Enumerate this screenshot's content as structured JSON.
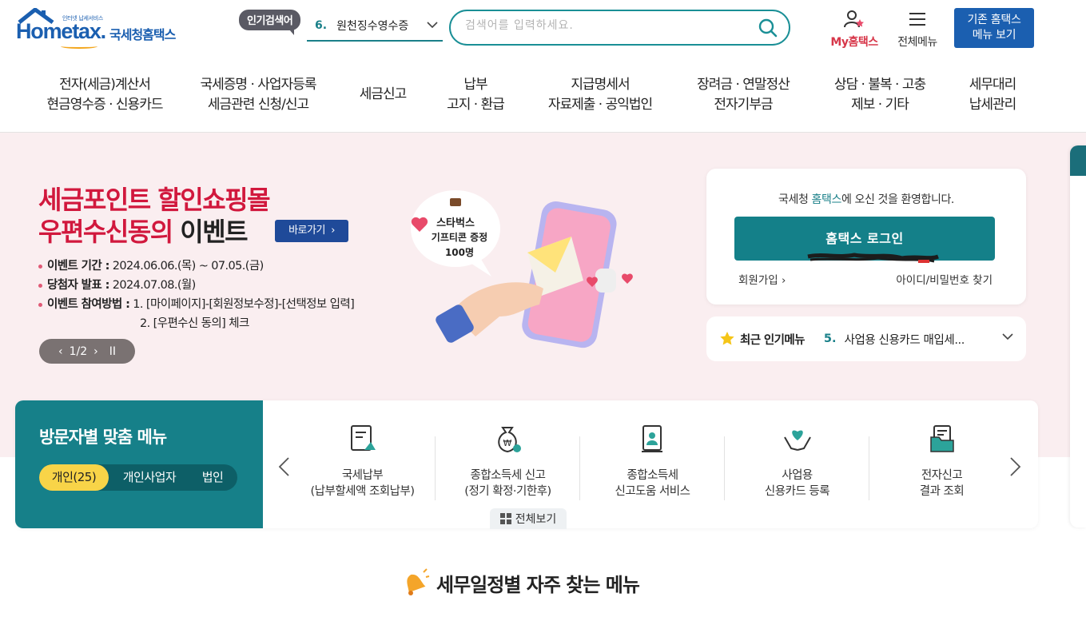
{
  "header": {
    "logo": {
      "small_text": "인터넷 납세서비스",
      "word": "Hometax.",
      "kor": "국세청홈택스"
    },
    "popular_badge": "인기검색어",
    "popular_num": "6.",
    "popular_term": "원천징수영수증",
    "search_placeholder": "검색어를 입력하세요.",
    "my_hometax": "My홈택스",
    "all_menu": "전체메뉴",
    "old_line1": "기존 홈택스",
    "old_line2": "메뉴 보기"
  },
  "gnb": [
    {
      "l1": "전자(세금)계산서",
      "l2": "현금영수증 · 신용카드"
    },
    {
      "l1": "국세증명 · 사업자등록",
      "l2": "세금관련 신청/신고"
    },
    {
      "l1": "세금신고",
      "l2": ""
    },
    {
      "l1": "납부",
      "l2": "고지 · 환급"
    },
    {
      "l1": "지급명세서",
      "l2": "자료제출 · 공익법인"
    },
    {
      "l1": "장려금 · 연말정산",
      "l2": "전자기부금"
    },
    {
      "l1": "상담 · 불복 · 고충",
      "l2": "제보 · 기타"
    },
    {
      "l1": "세무대리",
      "l2": "납세관리"
    }
  ],
  "banner": {
    "title1": "세금포인트 할인쇼핑몰",
    "title2_red": "우편수신동의",
    "title2_dark": " 이벤트",
    "go_button": "바로가기",
    "period_label": "이벤트 기간 :",
    "period_value": " 2024.06.06.(목) ~ 07.05.(금)",
    "winner_label": "당첨자 발표 :",
    "winner_value": " 2024.07.08.(월)",
    "method_label": "이벤트 참여방법 :",
    "method_value1": " 1. [마이페이지]-[회원정보수정]-[선택정보 입력]",
    "method_value2": "2. [우편수신 동의] 체크",
    "pager": "1/2",
    "bubble_line1": "스타벅스",
    "bubble_line2": "기프티콘 증정",
    "bubble_line3": "100명"
  },
  "login": {
    "welcome_pre": "국세청 ",
    "welcome_accent": "홈택스",
    "welcome_post": "에 오신 것을 환영합니다.",
    "button": "홈택스 로그인",
    "signup": "회원가입",
    "find": "아이디/비밀번호 찾기"
  },
  "recent": {
    "title": "최근 인기메뉴",
    "num": "5.",
    "text": "사업용 신용카드 매입세..."
  },
  "custom": {
    "title": "방문자별 맞춤 메뉴",
    "tabs": [
      "개인(25)",
      "개인사업자",
      "법인"
    ],
    "items": [
      {
        "l1": "국세납부",
        "l2": "(납부할세액 조회납부)",
        "icon": "tax-payment-icon"
      },
      {
        "l1": "종합소득세 신고",
        "l2": "(정기 확정·기한후)",
        "icon": "money-bag-icon"
      },
      {
        "l1": "종합소득세",
        "l2": "신고도움 서비스",
        "icon": "document-person-icon"
      },
      {
        "l1": "사업용",
        "l2": "신용카드 등록",
        "icon": "heart-hands-icon"
      },
      {
        "l1": "전자신고",
        "l2": "결과 조회",
        "icon": "folder-doc-icon"
      }
    ],
    "view_all": "전체보기"
  },
  "bottom": {
    "title": "세무일정별 자주 찾는 메뉴"
  },
  "colors": {
    "primary": "#168089",
    "brand": "#1b5fb0",
    "accent_red": "#d1183d"
  }
}
